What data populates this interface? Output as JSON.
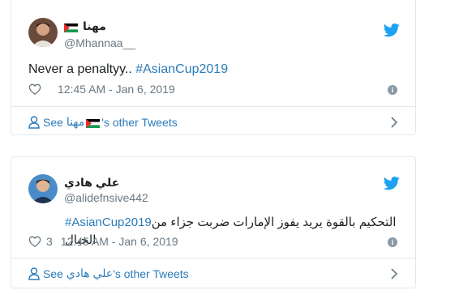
{
  "tweets": [
    {
      "display_name": "مهنا",
      "handle": "@Mhannaa__",
      "text_prefix": "Never a penaltyy.. ",
      "hashtag": "#AsianCup2019",
      "time": "12:45 AM - Jan 6, 2019",
      "like_count": "",
      "see_prefix": "See ",
      "see_name": "مهنا",
      "see_suffix": "'s other Tweets"
    },
    {
      "display_name": "علي هادي",
      "handle": "@alidefnsive442",
      "hashtag": "#AsianCup2019",
      "text_suffix": " التحكيم بالقوة يريد يفوز الإمارات ضربت جزاء من الخيال",
      "time": "12:45 AM - Jan 6, 2019",
      "like_count": "3",
      "see_prefix": "See ",
      "see_name": "علي هادي",
      "see_suffix": "'s other Tweets"
    }
  ],
  "icons": {
    "bird": "twitter-bird-icon",
    "heart": "heart-icon",
    "info": "info-icon",
    "person": "person-icon",
    "chevron": "chevron-right-icon",
    "flag": "palestine-flag-icon"
  },
  "colors": {
    "link": "#2b7bb9",
    "twitter_blue": "#1da1f2",
    "meta_gray": "#697882",
    "border": "#e1e8ed"
  }
}
